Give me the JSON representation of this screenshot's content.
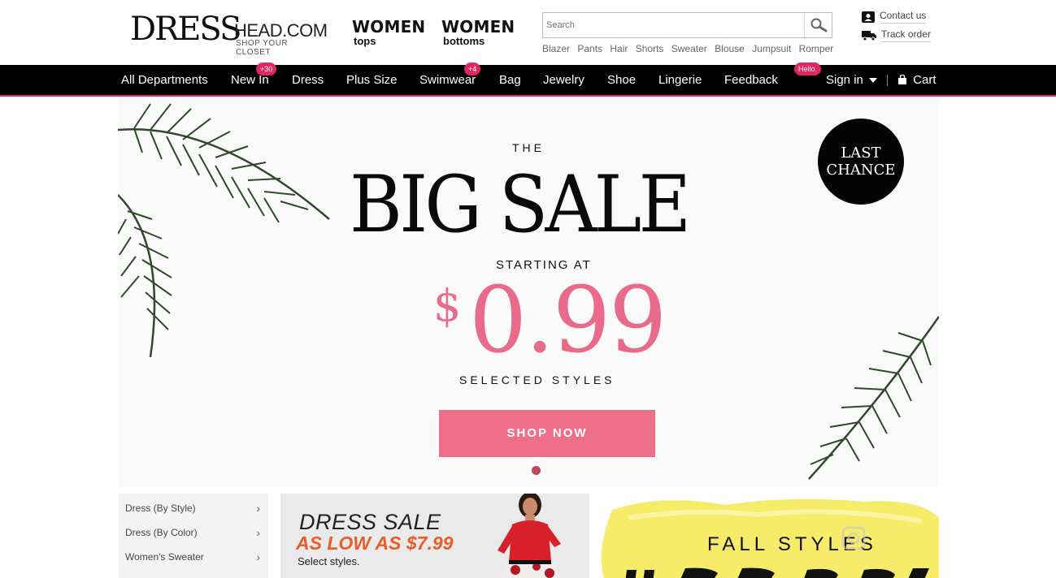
{
  "brand": {
    "name": "DRESS",
    "domain": "HEAD.COM",
    "tagline": "SHOP YOUR CLOSET"
  },
  "category_links": [
    {
      "title": "WOMEN",
      "subtitle": "tops"
    },
    {
      "title": "WOMEN",
      "subtitle": "bottoms"
    }
  ],
  "search": {
    "placeholder": "Search",
    "icon": "search-icon"
  },
  "hot_words": [
    "Blazer",
    "Pants",
    "Hair",
    "Shorts",
    "Sweater",
    "Blouse",
    "Jumpsuit",
    "Romper"
  ],
  "utility": {
    "contact": "Contact us",
    "track": "Track order"
  },
  "nav": {
    "items": [
      "All Departments",
      "New In",
      "Dress",
      "Plus Size",
      "Swimwear",
      "Bag",
      "Jewelry",
      "Shoe",
      "Lingerie",
      "Feedback"
    ],
    "badges": {
      "new_in": "+30",
      "swimwear": "+4",
      "feedback": "Hello."
    },
    "sign_in": "Sign in",
    "cart": "Cart"
  },
  "banner": {
    "the": "THE",
    "headline": "BIG SALE",
    "starting": "STARTING AT",
    "currency": "$",
    "price": "0.99",
    "selected": "SELECTED STYLES",
    "cta": "SHOP NOW",
    "stamp_line1": "LAST",
    "stamp_line2": "CHANCE"
  },
  "side_categories": [
    "Dress (By Style)",
    "Dress (By Color)",
    "Women's Sweater"
  ],
  "promo_dress": {
    "line1": "DRESS SALE",
    "line2": "AS LOW AS $7.99",
    "line3": "Select styles."
  },
  "promo_fall": {
    "line1": "FALL STYLES"
  },
  "colors": {
    "accent": "#e0285e",
    "banner_pink": "#ee6f8a",
    "nav_bg": "#000000"
  }
}
